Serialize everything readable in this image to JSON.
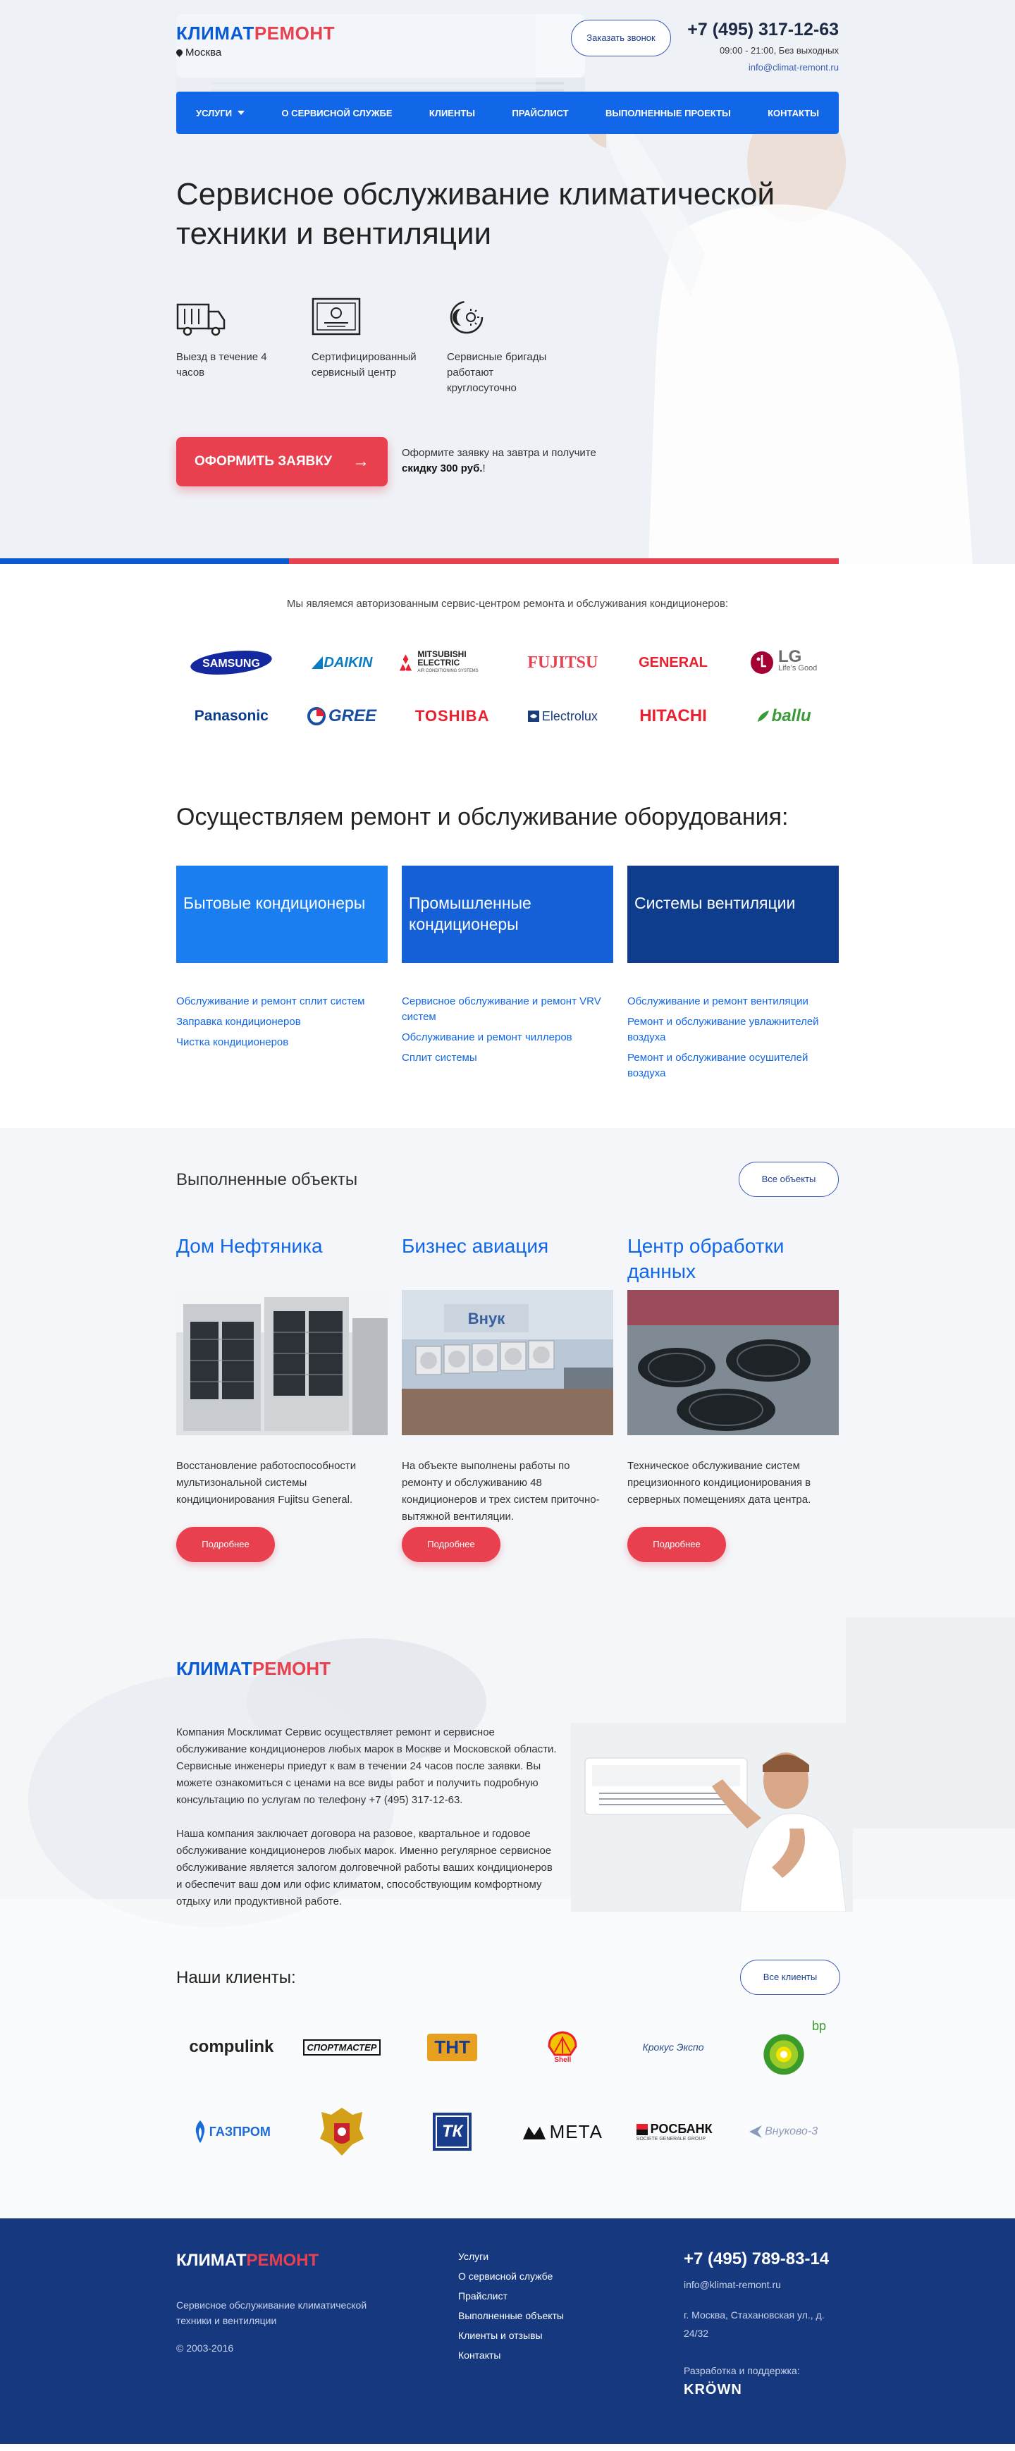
{
  "header": {
    "logo_part1": "КЛИМАТ",
    "logo_part2": "РЕМОНТ",
    "city": "Москва",
    "call_button": "Заказать звонок",
    "phone": "+7 (495) 317-12-63",
    "hours": "09:00 - 21:00, Без выходных",
    "email": "info@climat-remont.ru"
  },
  "nav": {
    "items": [
      "Услуги",
      "О сервисной службе",
      "Клиенты",
      "Прайслист",
      "Выполненные проекты",
      "Контакты"
    ]
  },
  "hero": {
    "title": "Сервисное обслуживание климатической техники и вентиляции",
    "features": [
      {
        "icon": "truck-icon",
        "text": "Выезд в течение 4 часов"
      },
      {
        "icon": "certificate-icon",
        "text": "Сертифицированный сервисный центр"
      },
      {
        "icon": "day-night-icon",
        "text": "Сервисные бригады работают круглосуточно"
      }
    ],
    "order_button": "ОФОРМИТЬ ЗАЯВКУ",
    "order_note_prefix": "Оформите заявку на завтра и получите ",
    "order_note_bold": "скидку 300 руб.",
    "order_note_suffix": "!"
  },
  "brands": {
    "note": "Мы являемся авторизованным сервис-центром ремонта и обслуживания кондиционеров:",
    "items": [
      {
        "name": "SAMSUNG",
        "color": "#1428a0"
      },
      {
        "name": "DAIKIN",
        "color": "#0a7cc4"
      },
      {
        "name": "MITSUBISHI ELECTRIC",
        "color": "#222222"
      },
      {
        "name": "FUJITSU",
        "color": "#e8404f"
      },
      {
        "name": "GENERAL",
        "color": "#e8202f"
      },
      {
        "name": "LG",
        "color": "#a50034"
      },
      {
        "name": "Panasonic",
        "color": "#0a3c8c"
      },
      {
        "name": "GREE",
        "color": "#1a4ea1"
      },
      {
        "name": "TOSHIBA",
        "color": "#e8202f"
      },
      {
        "name": "Electrolux",
        "color": "#1a3c7c"
      },
      {
        "name": "HITACHI",
        "color": "#e8202f"
      },
      {
        "name": "ballu",
        "color": "#3a9a3a"
      }
    ],
    "lg_tagline": "Life's Good",
    "mitsubishi_sub": "AIR CONDITIONING SYSTEMS"
  },
  "services": {
    "title": "Осуществляем ремонт и обслуживание оборудования:",
    "columns": [
      {
        "heading": "Бытовые кондиционеры",
        "color": "#1a7df0",
        "links": [
          "Обслуживание и ремонт сплит систем",
          "Заправка кондиционеров",
          "Чистка кондиционеров"
        ]
      },
      {
        "heading": "Промышленные кондиционеры",
        "color": "#1560d6",
        "links": [
          "Сервисное обслуживание и ремонт VRV систем",
          "Обслуживание и ремонт чиллеров",
          "Сплит системы"
        ]
      },
      {
        "heading": "Системы вентиляции",
        "color": "#0f3d8e",
        "links": [
          "Обслуживание и ремонт вентиляции",
          "Ремонт и обслуживание увлажнителей воздуха",
          "Ремонт и обслуживание осушителей воздуха"
        ]
      }
    ]
  },
  "projects": {
    "title": "Выполненные объекты",
    "all_button": "Все объекты",
    "items": [
      {
        "name": "Дом Нефтяника",
        "text": "Восстановление работоспособности мультизональной системы кондиционирования Fujitsu General.",
        "button": "Подробнее"
      },
      {
        "name": "Бизнес авиация",
        "text": "На объекте выполнены работы по ремонту и обслуживанию 48 кондиционеров и трех систем приточно-вытяжной вентиляции.",
        "button": "Подробнее"
      },
      {
        "name": "Центр обработки данных",
        "text": "Техническое обслуживание систем прецизионного кондиционирования в серверных помещениях дата центра.",
        "button": "Подробнее"
      }
    ]
  },
  "about": {
    "logo_part1": "КЛИМАТ",
    "logo_part2": "РЕМОНТ",
    "paragraph1": "Компания Москлимат Сервис осуществляет ремонт и сервисное обслуживание кондиционеров любых марок в Москве и Московской области. Сервисные инженеры приедут к вам в течении 24 часов после заявки. Вы можете ознакомиться с ценами на все виды работ и получить подробную консультацию по услугам по телефону +7 (495) 317-12-63.",
    "paragraph2": "Наша компания заключает договора на разовое, квартальное и годовое обслуживание кондиционеров любых марок. Именно регулярное сервисное обслуживание является залогом долговечной работы ваших кондиционеров и обеспечит ваш дом или офис климатом, способствующим комфортному отдыху или продуктивной работе.",
    "clients_title": "Наши клиенты:",
    "clients_button": "Все клиенты",
    "clients": [
      {
        "name": "compulink",
        "color": "#222222"
      },
      {
        "name": "СПОРТМАСТЕР",
        "color": "#222222"
      },
      {
        "name": "ТНТ",
        "color": "#e8a020"
      },
      {
        "name": "Shell",
        "color": "#e8202f"
      },
      {
        "name": "Крокус Экспо",
        "color": "#2a4a8a"
      },
      {
        "name": "bp",
        "color": "#3a9a2a"
      },
      {
        "name": "ГАЗПРОМ",
        "color": "#1a6ad8"
      },
      {
        "name": "coat-of-arms",
        "color": "#c8202f"
      },
      {
        "name": "ТК",
        "color": "#1a3c8c"
      },
      {
        "name": "МЕТА",
        "color": "#111111"
      },
      {
        "name": "РОСБАНК",
        "color": "#111111"
      },
      {
        "name": "Внуково-3",
        "color": "#8a9ab8"
      }
    ],
    "rosbank_sub": "SOCIETE GENERALE GROUP"
  },
  "footer": {
    "logo_part1": "КЛИМАТ",
    "logo_part2": "РЕМОНТ",
    "description": "Сервисное обслуживание климатической техники и вентиляции",
    "copyright": "© 2003-2016",
    "menu": [
      "Услуги",
      "О сервисной службе",
      "Прайслист",
      "Выполненные объекты",
      "Клиенты и отзывы",
      "Контакты"
    ],
    "phone": "+7 (495) 789-83-14",
    "email": "info@klimat-remont.ru",
    "address": "г. Москва, Стахановская ул., д. 24/32",
    "dev_label": "Разработка и поддержка:",
    "dev_name": "KRÖWN"
  }
}
